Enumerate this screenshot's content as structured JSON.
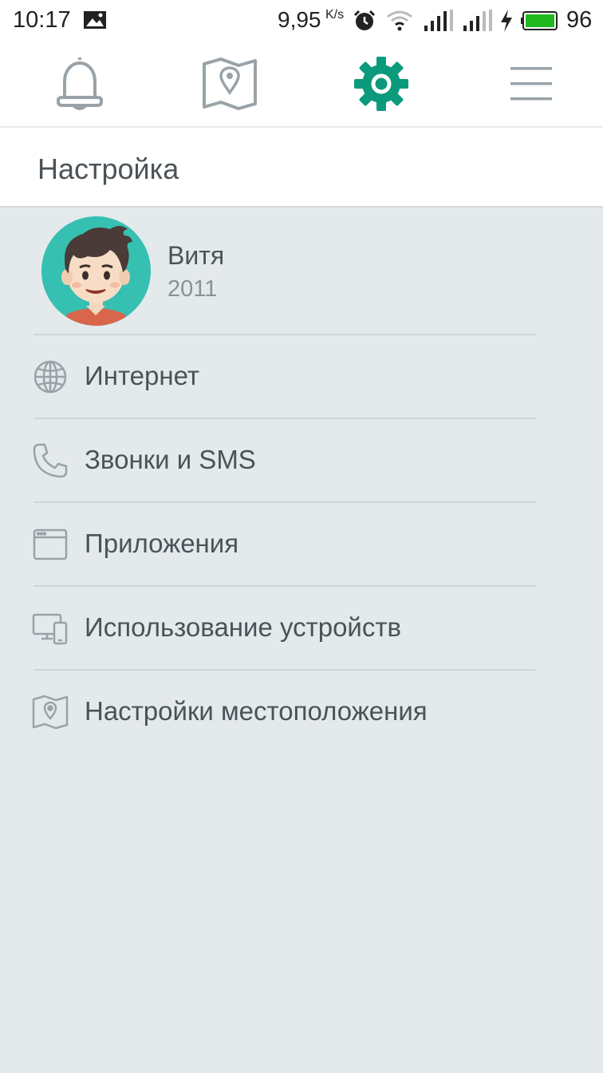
{
  "status_bar": {
    "time": "10:17",
    "net_speed": "9,95",
    "net_unit": "K/s",
    "battery_level": "96",
    "icons": [
      "image-icon",
      "alarm-icon",
      "wifi-icon",
      "signal-icon",
      "signal-icon",
      "charging-icon",
      "battery-icon"
    ]
  },
  "nav": {
    "items": [
      {
        "name": "notifications",
        "icon": "bell-icon",
        "active": false
      },
      {
        "name": "map",
        "icon": "map-pin-icon",
        "active": false
      },
      {
        "name": "settings",
        "icon": "gear-icon",
        "active": true
      },
      {
        "name": "menu",
        "icon": "hamburger-menu-icon",
        "active": false
      }
    ],
    "active_color": "#0c9a7c",
    "inactive_color": "#98a3a8"
  },
  "header": {
    "title": "Настройка"
  },
  "profile": {
    "name": "Витя",
    "year": "2011",
    "avatar_bg": "#36c0b2"
  },
  "menu": {
    "items": [
      {
        "label": "Интернет",
        "icon": "globe-icon"
      },
      {
        "label": "Звонки и SMS",
        "icon": "phone-icon"
      },
      {
        "label": "Приложения",
        "icon": "app-window-icon"
      },
      {
        "label": "Использование устройств",
        "icon": "devices-icon"
      },
      {
        "label": "Настройки местоположения",
        "icon": "location-map-icon"
      }
    ]
  }
}
